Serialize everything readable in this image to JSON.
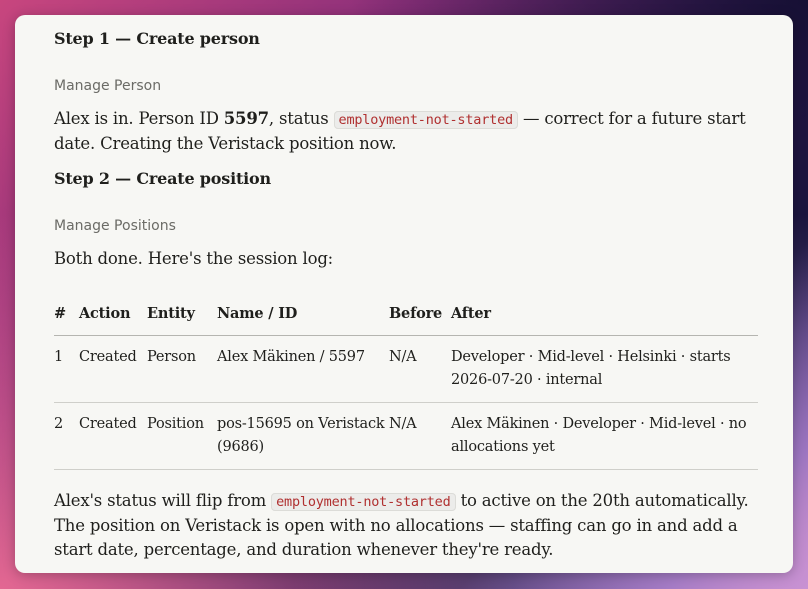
{
  "steps": [
    {
      "heading": "Step 1 — Create person",
      "tool": "Manage Person"
    },
    {
      "heading": "Step 2 — Create position",
      "tool": "Manage Positions"
    }
  ],
  "para1": {
    "prefix": "Alex is in. Person ID ",
    "person_id": "5597",
    "mid": ", status ",
    "status_code": "employment-not-started",
    "suffix": " — correct for a future start date. Creating the Veristack position now."
  },
  "para2": "Both done. Here's the session log:",
  "table": {
    "headers": [
      "#",
      "Action",
      "Entity",
      "Name / ID",
      "Before",
      "After"
    ],
    "rows": [
      [
        "1",
        "Created",
        "Person",
        "Alex Mäkinen / 5597",
        "N/A",
        "Developer · Mid-level · Helsinki · starts 2026-07-20 · internal"
      ],
      [
        "2",
        "Created",
        "Position",
        "pos-15695 on Veristack (9686)",
        "N/A",
        "Alex Mäkinen · Developer · Mid-level · no allocations yet"
      ]
    ]
  },
  "para3": {
    "prefix": "Alex's status will flip from ",
    "status_code": "employment-not-started",
    "suffix": " to active on the 20th automatically. The position on Veristack is open with no allocations — staffing can go in and add a start date, percentage, and duration whenever they're ready."
  }
}
